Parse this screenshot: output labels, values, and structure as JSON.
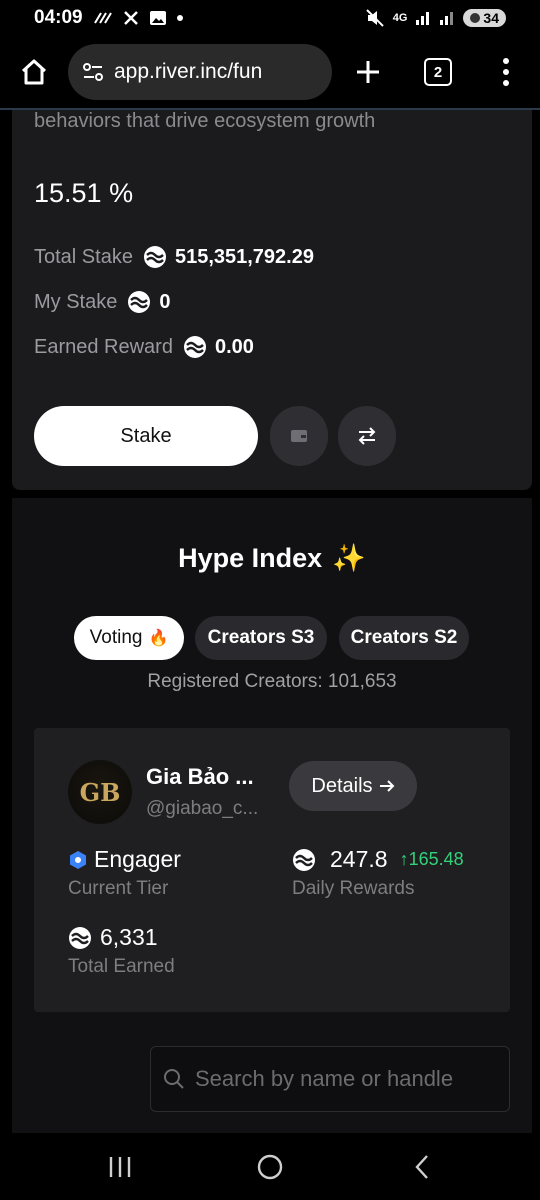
{
  "status_bar": {
    "time": "04:09",
    "network": "4G",
    "battery": "34"
  },
  "browser": {
    "url": "app.river.inc/fun",
    "tab_count": "2"
  },
  "stake": {
    "tagline": "behaviors that drive ecosystem growth",
    "apr": "15.51 %",
    "total_stake_label": "Total Stake",
    "total_stake_value": "515,351,792.29",
    "my_stake_label": "My Stake",
    "my_stake_value": "0",
    "earned_label": "Earned Reward",
    "earned_value": "0.00",
    "stake_button": "Stake"
  },
  "hype": {
    "title": "Hype Index",
    "sparkle": "✨",
    "tabs": [
      {
        "label": "Voting",
        "emoji": "🔥",
        "active": true
      },
      {
        "label": "Creators S3",
        "active": false
      },
      {
        "label": "Creators S2",
        "active": false
      }
    ],
    "registered": "Registered Creators: 101,653"
  },
  "creator": {
    "avatar_text": "GB",
    "name": "Gia Bảo ...",
    "handle": "@giabao_c...",
    "details_button": "Details",
    "tier_value": "Engager",
    "tier_label": "Current Tier",
    "daily_value": "247.8",
    "daily_delta": "↑165.48",
    "daily_label": "Daily Rewards",
    "total_value": "6,331",
    "total_label": "Total Earned"
  },
  "search": {
    "placeholder": "Search by name or handle"
  },
  "colors": {
    "accent_green": "#33d17a",
    "sparkle": "#b388ff",
    "card": "#1b1b1e",
    "tier_icon": "#3b82f6"
  }
}
